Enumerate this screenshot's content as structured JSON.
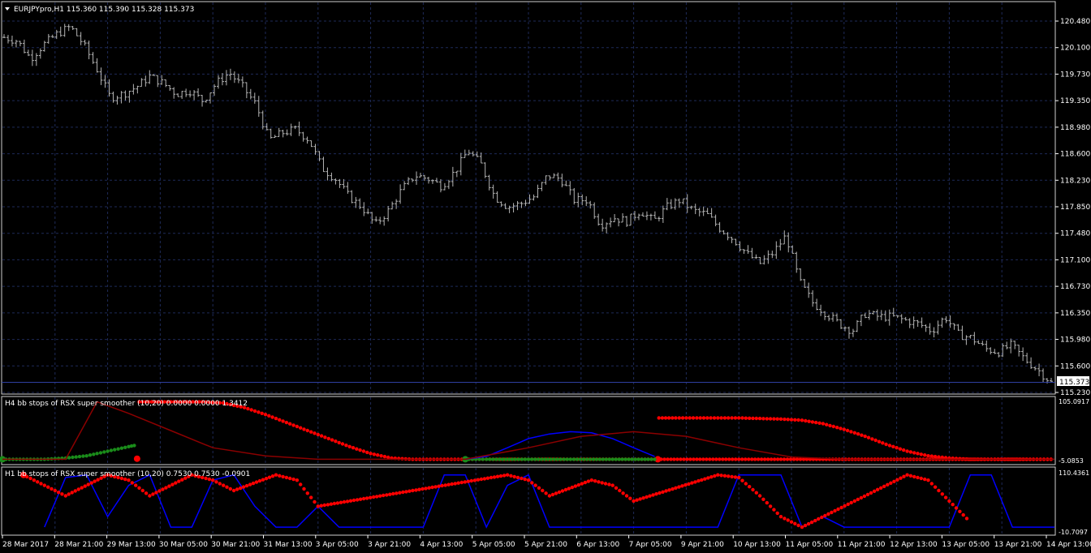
{
  "main_panel": {
    "title": "EURJPYpro,H1  115.360 115.390 115.328 115.373",
    "price_ticks": [
      "120.480",
      "120.100",
      "119.730",
      "119.350",
      "118.980",
      "118.600",
      "118.230",
      "117.850",
      "117.480",
      "117.100",
      "116.730",
      "116.350",
      "115.980",
      "115.600",
      "115.230"
    ],
    "current_price_label": "115.373"
  },
  "h4_panel": {
    "title": "H4 bb stops of RSX super smoother (10,20) 0.0000 0.0000 1.3412",
    "tick_top": "105.0917",
    "tick_bottom": "-5.0853"
  },
  "h1_panel": {
    "title": "H1 bb stops of RSX super smoother (10,20) 0.7530 0.7530 -0.0901",
    "tick_top": "110.4361",
    "tick_bottom": "-10.7097"
  },
  "time_labels": [
    "28 Mar 2017",
    "28 Mar 21:00",
    "29 Mar 13:00",
    "30 Mar 05:00",
    "30 Mar 21:00",
    "31 Mar 13:00",
    "3 Apr 05:00",
    "3 Apr 21:00",
    "4 Apr 13:00",
    "5 Apr 05:00",
    "5 Apr 21:00",
    "6 Apr 13:00",
    "7 Apr 05:00",
    "9 Apr 21:00",
    "10 Apr 13:00",
    "11 Apr 05:00",
    "11 Apr 21:00",
    "12 Apr 13:00",
    "13 Apr 05:00",
    "13 Apr 21:00",
    "14 Apr 13:00"
  ],
  "colors": {
    "background": "#000000",
    "grid": "#1e2a58",
    "bars": "#b4b4b4",
    "axis_text": "#ffffff",
    "current_price_line": "#2f3fa0",
    "stop_up": "#ff0000",
    "stop_down": "#1a8c1a",
    "rsx_up": "#0000ff",
    "rsx_down": "#8b0000"
  },
  "chart_data": [
    {
      "type": "ohlc",
      "symbol": "EURJPYpro",
      "timeframe": "H1",
      "last_bar": {
        "open": 115.36,
        "high": 115.39,
        "low": 115.328,
        "close": 115.373
      },
      "ylim": [
        115.23,
        120.48
      ],
      "x_ticks": [
        "28 Mar 2017",
        "28 Mar 21:00",
        "29 Mar 13:00",
        "30 Mar 05:00",
        "30 Mar 21:00",
        "31 Mar 13:00",
        "3 Apr 05:00",
        "3 Apr 21:00",
        "4 Apr 13:00",
        "5 Apr 05:00",
        "5 Apr 21:00",
        "6 Apr 13:00",
        "7 Apr 05:00",
        "9 Apr 21:00",
        "10 Apr 13:00",
        "11 Apr 05:00",
        "11 Apr 21:00",
        "12 Apr 13:00",
        "13 Apr 05:00",
        "13 Apr 21:00",
        "14 Apr 13:00"
      ],
      "close_path": [
        120.25,
        120.2,
        119.95,
        120.15,
        120.3,
        120.4,
        120.15,
        119.8,
        119.4,
        119.45,
        119.55,
        119.7,
        119.6,
        119.45,
        119.5,
        119.35,
        119.6,
        119.75,
        119.55,
        119.3,
        118.8,
        118.9,
        118.95,
        118.8,
        118.4,
        118.25,
        118.0,
        117.85,
        117.6,
        117.8,
        118.1,
        118.3,
        118.25,
        118.15,
        118.35,
        118.65,
        118.45,
        118.0,
        117.85,
        117.9,
        118.0,
        118.3,
        118.25,
        117.95,
        117.95,
        117.6,
        117.7,
        117.65,
        117.8,
        117.65,
        117.85,
        117.95,
        117.8,
        117.75,
        117.55,
        117.4,
        117.2,
        117.05,
        117.2,
        117.45,
        116.8,
        116.5,
        116.35,
        116.2,
        116.1,
        116.35,
        116.3,
        116.3,
        116.25,
        116.2,
        116.1,
        116.3,
        116.05,
        116.0,
        115.85,
        115.8,
        115.9,
        115.7,
        115.55,
        115.37
      ]
    },
    {
      "type": "line",
      "title": "H4 bb stops of RSX super smoother (10,20) 0.0000 0.0000 1.3412",
      "ylim": [
        -5.0853,
        105.0917
      ],
      "series": [
        {
          "style": "dots-red",
          "x": [
            0.128,
            0.13,
            0.16,
            0.19,
            0.21,
            0.23,
            0.25,
            0.27,
            0.29,
            0.31,
            0.33,
            0.35,
            0.37,
            0.39,
            0.41,
            0.43,
            0.45,
            0.47,
            0.49,
            0.51,
            0.53,
            0.55,
            0.58,
            0.62,
            0.66,
            0.7,
            0.74,
            0.78,
            0.82,
            0.86,
            0.9,
            0.94,
            0.98,
            1.0
          ],
          "y": [
            1,
            100,
            100,
            100,
            98,
            90,
            78,
            64,
            50,
            36,
            22,
            10,
            2,
            0,
            0,
            0,
            0,
            0,
            0,
            0,
            0,
            0,
            0,
            0,
            0,
            0,
            0,
            0,
            0,
            0,
            0,
            0,
            0,
            0
          ]
        },
        {
          "style": "dots-red",
          "x": [
            0.623,
            0.624,
            0.64,
            0.66,
            0.68,
            0.7,
            0.72,
            0.74,
            0.76,
            0.78,
            0.8,
            0.82,
            0.84,
            0.86,
            0.88,
            0.9,
            0.92,
            0.94,
            0.96,
            0.98,
            1.0
          ],
          "y": [
            0,
            72,
            72,
            72,
            72,
            72,
            71,
            70,
            68,
            62,
            52,
            40,
            26,
            14,
            6,
            2,
            0,
            0,
            0,
            0,
            0
          ]
        },
        {
          "style": "dots-green",
          "x": [
            0.0,
            0.02,
            0.04,
            0.06,
            0.08,
            0.1,
            0.12,
            0.128
          ],
          "y": [
            0,
            0,
            0,
            2,
            6,
            14,
            22,
            25
          ]
        },
        {
          "style": "dots-green",
          "x": [
            0.44,
            0.46,
            0.5,
            0.54,
            0.58,
            0.62,
            0.623
          ],
          "y": [
            0,
            0,
            0,
            0,
            0,
            0,
            1
          ]
        },
        {
          "style": "line-blue",
          "x": [
            0.44,
            0.46,
            0.48,
            0.5,
            0.52,
            0.54,
            0.56,
            0.58,
            0.6,
            0.62
          ],
          "y": [
            0,
            5,
            20,
            36,
            44,
            48,
            46,
            36,
            20,
            5
          ]
        },
        {
          "style": "line-red",
          "x": [
            0.0,
            0.06,
            0.09,
            0.12,
            0.16,
            0.2,
            0.25,
            0.3,
            0.35,
            0.4,
            0.44,
            0.5,
            0.55,
            0.6,
            0.65,
            0.7,
            0.75,
            0.8,
            0.85,
            0.9,
            0.95,
            1.0
          ],
          "y": [
            0,
            0,
            100,
            80,
            50,
            20,
            6,
            0,
            0,
            0,
            0,
            20,
            40,
            48,
            40,
            20,
            4,
            0,
            0,
            0,
            0,
            0
          ]
        }
      ]
    },
    {
      "type": "line",
      "title": "H1 bb stops of RSX super smoother (10,20) 0.7530 0.7530 -0.0901",
      "ylim": [
        -10.7097,
        110.4361
      ],
      "series": [
        {
          "style": "line-blue",
          "x": [
            0.04,
            0.06,
            0.08,
            0.1,
            0.12,
            0.14,
            0.16,
            0.18,
            0.2,
            0.22,
            0.24,
            0.26,
            0.28,
            0.3,
            0.32,
            0.34,
            0.36,
            0.38,
            0.4,
            0.42,
            0.44,
            0.46,
            0.48,
            0.5,
            0.52,
            0.54,
            0.56,
            0.58,
            0.6,
            0.62,
            0.64,
            0.66,
            0.68,
            0.7,
            0.72,
            0.74,
            0.76,
            0.78,
            0.8,
            0.82,
            0.84,
            0.86,
            0.88,
            0.9,
            0.92,
            0.94,
            0.96,
            0.98,
            1.0
          ],
          "y": [
            0,
            95,
            100,
            20,
            80,
            100,
            0,
            0,
            90,
            100,
            40,
            0,
            0,
            40,
            0,
            0,
            0,
            0,
            0,
            100,
            100,
            0,
            80,
            100,
            0,
            0,
            0,
            0,
            0,
            0,
            0,
            0,
            0,
            100,
            100,
            100,
            0,
            20,
            0,
            0,
            0,
            0,
            0,
            0,
            100,
            100,
            0,
            0,
            0
          ]
        },
        {
          "style": "dots-red",
          "x": [
            0.02,
            0.04,
            0.06,
            0.1,
            0.12,
            0.14,
            0.18,
            0.2,
            0.22,
            0.26,
            0.28,
            0.3,
            0.48,
            0.5,
            0.52,
            0.56,
            0.58,
            0.6,
            0.68,
            0.7,
            0.72,
            0.74,
            0.76,
            0.86,
            0.88,
            0.9,
            0.92
          ],
          "y": [
            100,
            80,
            60,
            100,
            90,
            60,
            100,
            90,
            70,
            100,
            90,
            40,
            100,
            90,
            60,
            90,
            80,
            50,
            100,
            95,
            60,
            20,
            0,
            100,
            90,
            50,
            10
          ]
        }
      ]
    }
  ]
}
